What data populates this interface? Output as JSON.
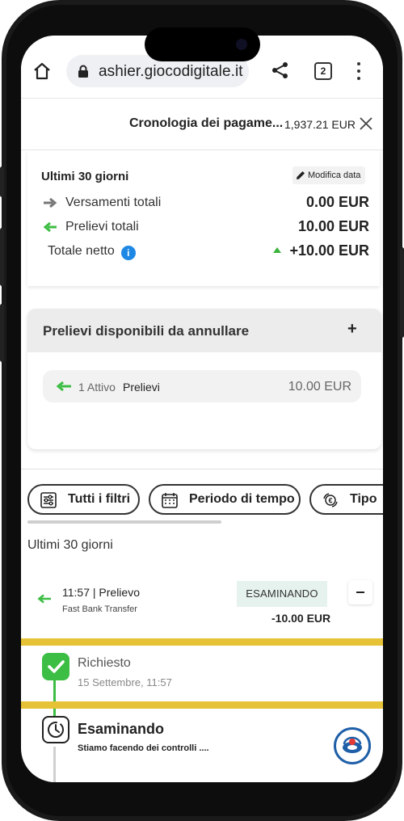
{
  "browser": {
    "url": "ashier.giocodigitale.it",
    "tab_count": "2"
  },
  "header": {
    "title": "Cronologia dei pagame...",
    "balance": "1,937.21 EUR"
  },
  "summary": {
    "period": "Ultimi 30 giorni",
    "edit_date_label": "Modifica data",
    "deposits_label": "Versamenti totali",
    "deposits_value": "0.00 EUR",
    "withdrawals_label": "Prelievi totali",
    "withdrawals_value": "10.00 EUR",
    "net_label": "Totale netto",
    "net_value": "+10.00 EUR"
  },
  "available": {
    "title": "Prelievi disponibili da annullare",
    "expand_symbol": "+",
    "item_count": "1 Attivo",
    "item_label": "Prelievi",
    "item_amount": "10.00 EUR"
  },
  "filters": {
    "all_filters": "Tutti i filtri",
    "time_period": "Periodo di tempo",
    "type": "Tipo"
  },
  "list": {
    "period": "Ultimi 30 giorni"
  },
  "transaction": {
    "time_type": "11:57 | Prelievo",
    "method": "Fast Bank Transfer",
    "status": "ESAMINANDO",
    "amount": "-10.00 EUR"
  },
  "timeline": {
    "step1_title": "Richiesto",
    "step1_date": "15 Settembre, 11:57",
    "step2_title": "Esaminando",
    "step2_desc": "Stiamo facendo dei controlli ...."
  },
  "colors": {
    "accent_green": "#3cbd43",
    "info_blue": "#1e88e5",
    "highlight_yellow": "#e5c236",
    "status_badge_bg": "#e6f2ee"
  },
  "icons": [
    "home-icon",
    "lock-icon",
    "share-icon",
    "tabs-icon",
    "more-vert-icon",
    "close-icon",
    "pencil-icon",
    "arrow-right-icon",
    "arrow-left-icon",
    "info-icon",
    "plus-icon",
    "filter-icon",
    "calendar-icon",
    "currency-exchange-icon",
    "collapse-icon",
    "check-icon",
    "clock-icon",
    "chat-icon"
  ]
}
